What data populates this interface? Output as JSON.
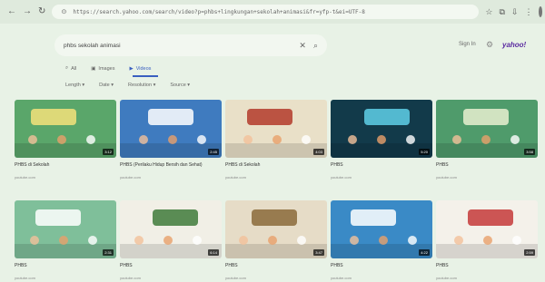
{
  "browser": {
    "url": "https://search.yahoo.com/search/video?p=phbs+lingkungan+sekolah+animasi&fr=yfp-t&ei=UTF-8",
    "back_icon": "back-arrow-icon",
    "forward_icon": "forward-arrow-icon",
    "reload_icon": "reload-icon"
  },
  "search": {
    "query": "phbs sekolah animasi",
    "signin": "Sign In",
    "brand": "yahoo!"
  },
  "tabs": [
    {
      "label": "All",
      "icon": "magnifier-icon"
    },
    {
      "label": "Images",
      "icon": "image-icon"
    },
    {
      "label": "Videos",
      "icon": "play-icon",
      "active": true
    }
  ],
  "filters": [
    "Length",
    "Date",
    "Resolution",
    "Source"
  ],
  "videos": [
    {
      "title": "PHBS di Sekolah",
      "sub": "youtube.com",
      "sub2": "",
      "duration": "3:12",
      "bg": "#5aa66a",
      "accent": "#f4e27a"
    },
    {
      "title": "PHBS (Perilaku Hidup Bersih dan Sehat)",
      "sub": "youtube.com",
      "sub2": "",
      "duration": "2:45",
      "bg": "#3f7bbf",
      "accent": "#ffffff"
    },
    {
      "title": "PHBS di Sekolah",
      "sub": "youtube.com",
      "sub2": "",
      "duration": "4:03",
      "bg": "#e9e0c8",
      "accent": "#b33a2a"
    },
    {
      "title": "PHBS",
      "sub": "youtube.com",
      "sub2": "",
      "duration": "5:20",
      "bg": "#123a4a",
      "accent": "#5fd0e8"
    },
    {
      "title": "PHBS",
      "sub": "youtube.com",
      "sub2": "",
      "duration": "3:58",
      "bg": "#4f9b6b",
      "accent": "#e8f0d0"
    },
    {
      "title": "PHBS",
      "sub": "youtube.com",
      "sub2": "",
      "duration": "2:31",
      "bg": "#7fbf9a",
      "accent": "#ffffff"
    },
    {
      "title": "PHBS",
      "sub": "youtube.com",
      "sub2": "",
      "duration": "6:14",
      "bg": "#f1efe6",
      "accent": "#3f7a3a"
    },
    {
      "title": "PHBS",
      "sub": "youtube.com",
      "sub2": "",
      "duration": "3:47",
      "bg": "#e6dcc7",
      "accent": "#8a6a3a"
    },
    {
      "title": "PHBS",
      "sub": "youtube.com",
      "sub2": "",
      "duration": "4:22",
      "bg": "#3a8ac6",
      "accent": "#ffffff"
    },
    {
      "title": "PHBS",
      "sub": "youtube.com",
      "sub2": "",
      "duration": "2:59",
      "bg": "#f4f1ea",
      "accent": "#c43a3a"
    }
  ]
}
